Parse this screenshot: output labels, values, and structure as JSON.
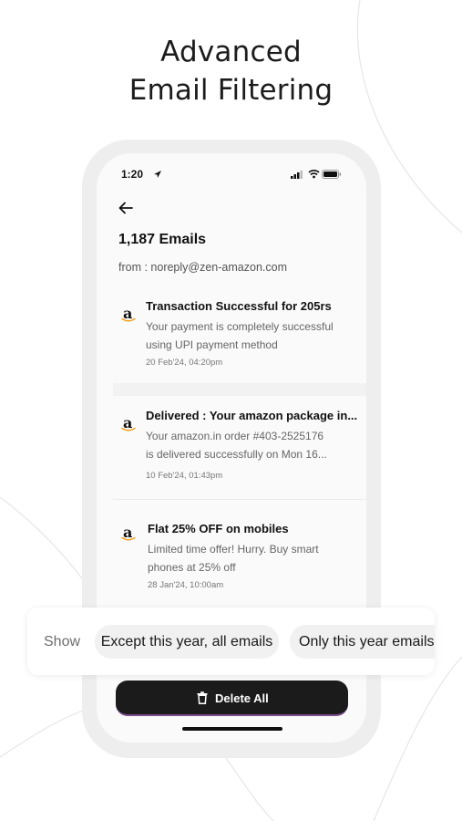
{
  "headline": {
    "line1": "Advanced",
    "line2": "Email Filtering"
  },
  "phone": {
    "status": {
      "time": "1:20"
    },
    "count_title": "1,187 Emails",
    "from_line": "from : noreply@zen-amazon.com",
    "emails": [
      {
        "sender_logo": "a",
        "subject": "Transaction Successful for 205rs",
        "preview_line1": "Your payment is completely successful",
        "preview_line2": "using UPI payment method",
        "date": "20 Feb'24, 04:20pm"
      },
      {
        "sender_logo": "a",
        "subject": "Delivered : Your amazon package in...",
        "preview_line1": "Your amazon.in order #403-2525176",
        "preview_line2": "is delivered successfully on Mon 16...",
        "date": "10 Feb'24, 01:43pm"
      },
      {
        "sender_logo": "a",
        "subject": "Flat 25% OFF on mobiles",
        "preview_line1": "Limited time offer! Hurry. Buy smart",
        "preview_line2": "phones at 25% off",
        "date": "28 Jan'24, 10:00am"
      }
    ],
    "delete_button": "Delete All"
  },
  "filter": {
    "label": "Show",
    "options": [
      "Except this year, all emails",
      "Only this year emails"
    ]
  },
  "colors": {
    "button_bg": "#1b1b1b",
    "chip_bg": "#f1f1f1",
    "amazon_smile": "#f0a11c"
  }
}
